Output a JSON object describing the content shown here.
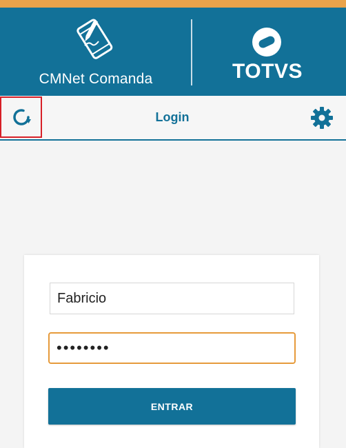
{
  "header": {
    "app_name": "CMNet Comanda",
    "app_icon": "tablet-pen-icon",
    "brand_name": "TOTVS",
    "brand_icon": "totvs-logo-icon"
  },
  "toolbar": {
    "refresh_icon": "refresh-icon",
    "title": "Login",
    "settings_icon": "gear-icon"
  },
  "login": {
    "username_value": "Fabricio",
    "password_value": "••••••••",
    "enter_label": "ENTRAR"
  },
  "colors": {
    "primary": "#127198",
    "accent_stripe": "#e9a34b",
    "focus_border": "#e69a3a",
    "highlight_box": "#d71f27",
    "background": "#f4f4f4"
  }
}
